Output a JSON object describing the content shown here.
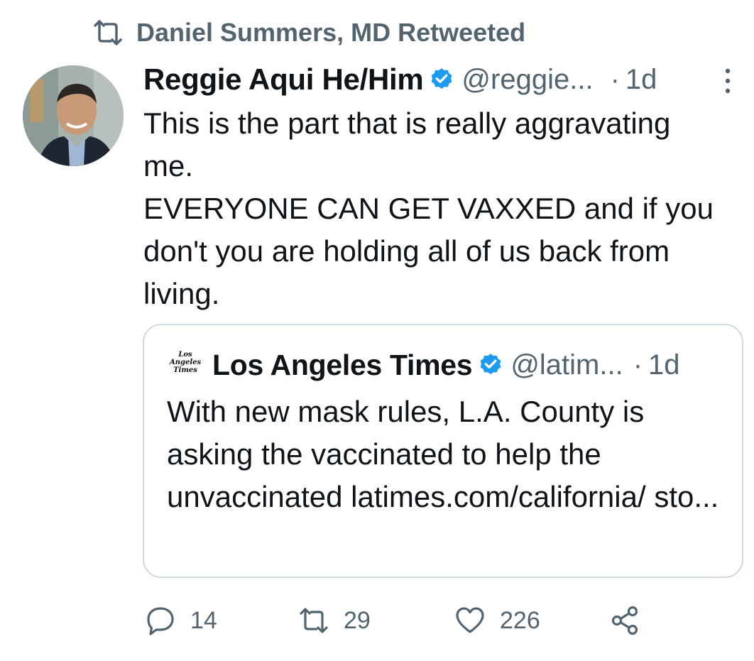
{
  "retweet_context": {
    "label": "Daniel Summers, MD Retweeted",
    "icon": "retweet-icon"
  },
  "tweet": {
    "author_name": "Reggie Aqui He/Him",
    "verified": true,
    "handle": "@reggie...",
    "separator": "·",
    "time": "1d",
    "text": "This is the part that is really aggravating\nme.\nEVERYONE CAN GET VAXXED and if you\ndon't you are holding all of us back from\nliving."
  },
  "quote": {
    "logo_text": [
      "Los",
      "Angeles",
      "Times"
    ],
    "author_name": "Los Angeles Times",
    "verified": true,
    "handle": "@latim...",
    "separator": "·",
    "time": "1d",
    "text": "With new mask rules, L.A. County is asking the vaccinated to help the unvaccinated latimes.com/california/ sto..."
  },
  "actions": {
    "reply_count": "14",
    "retweet_count": "29",
    "like_count": "226"
  },
  "colors": {
    "text": "#0f1419",
    "secondary": "#536471",
    "verified": "#1d9bf0",
    "border": "#cfd9de"
  }
}
